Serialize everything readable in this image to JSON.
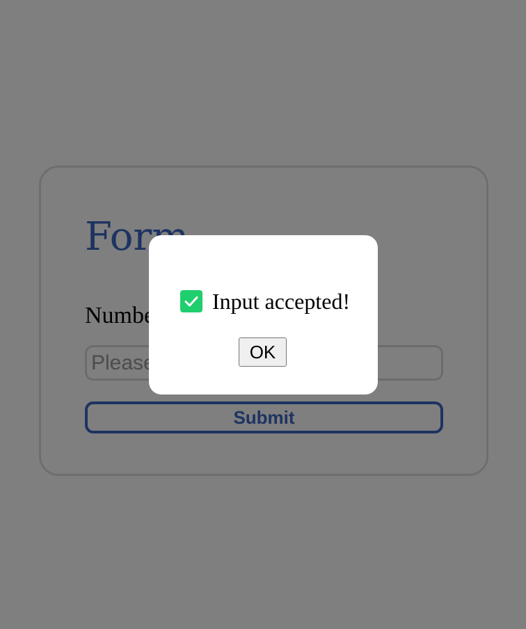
{
  "form": {
    "title": "Form",
    "number_label": "Number",
    "number_input": {
      "value": "",
      "placeholder": "Please enter a number"
    },
    "submit_label": "Submit"
  },
  "dialog": {
    "icon": "check-icon",
    "message": "Input accepted!",
    "ok_label": "OK"
  },
  "colors": {
    "accent": "#3a66c4",
    "success": "#1fce6d",
    "overlay": "rgba(0, 0, 0, 0.5)"
  }
}
